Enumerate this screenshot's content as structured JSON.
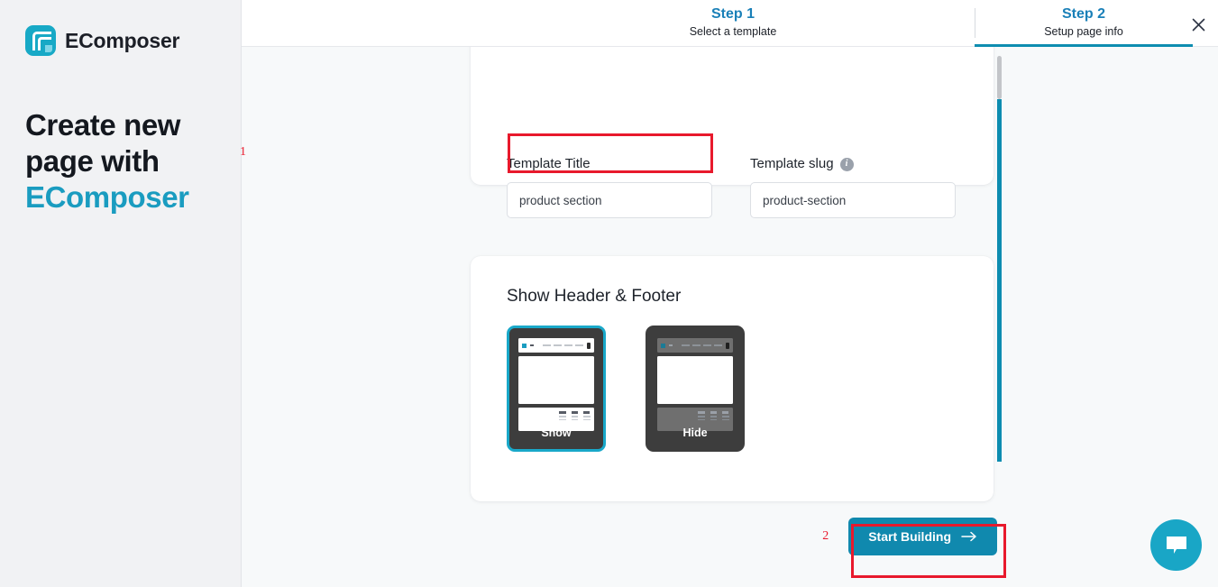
{
  "sidebar": {
    "brand_name": "EComposer",
    "logo_icon": "ecomposer-logo-icon",
    "headline_line1": "Create new",
    "headline_line2": "page with",
    "headline_accent": "EComposer"
  },
  "topbar": {
    "steps": [
      {
        "title": "Step 1",
        "subtitle": "Select a template",
        "active": false
      },
      {
        "title": "Step 2",
        "subtitle": "Setup page info",
        "active": true
      }
    ],
    "close_icon": "close-icon"
  },
  "info_card": {
    "title_label": "Template Title",
    "title_value": "product section",
    "title_placeholder": "Template Title",
    "slug_label": "Template slug",
    "slug_info_icon": "info-icon",
    "slug_value": "product-section",
    "slug_placeholder": "Template slug"
  },
  "header_footer_card": {
    "heading": "Show Header & Footer",
    "options": [
      {
        "label": "Show",
        "selected": true
      },
      {
        "label": "Hide",
        "selected": false
      }
    ]
  },
  "footer": {
    "start_button_label": "Start Building",
    "arrow_icon": "arrow-right-icon"
  },
  "annotations": {
    "marker_1": "1",
    "marker_2": "2"
  },
  "chat": {
    "icon": "chat-bubble-icon"
  },
  "colors": {
    "accent_teal": "#1089ae",
    "logo_teal": "#17a9c6",
    "step_blue": "#1a80b8",
    "annotation_red": "#e8192c",
    "sidebar_bg": "#f1f2f4",
    "main_bg": "#f7f9fa",
    "thumb_bg": "#3d3d3d"
  }
}
